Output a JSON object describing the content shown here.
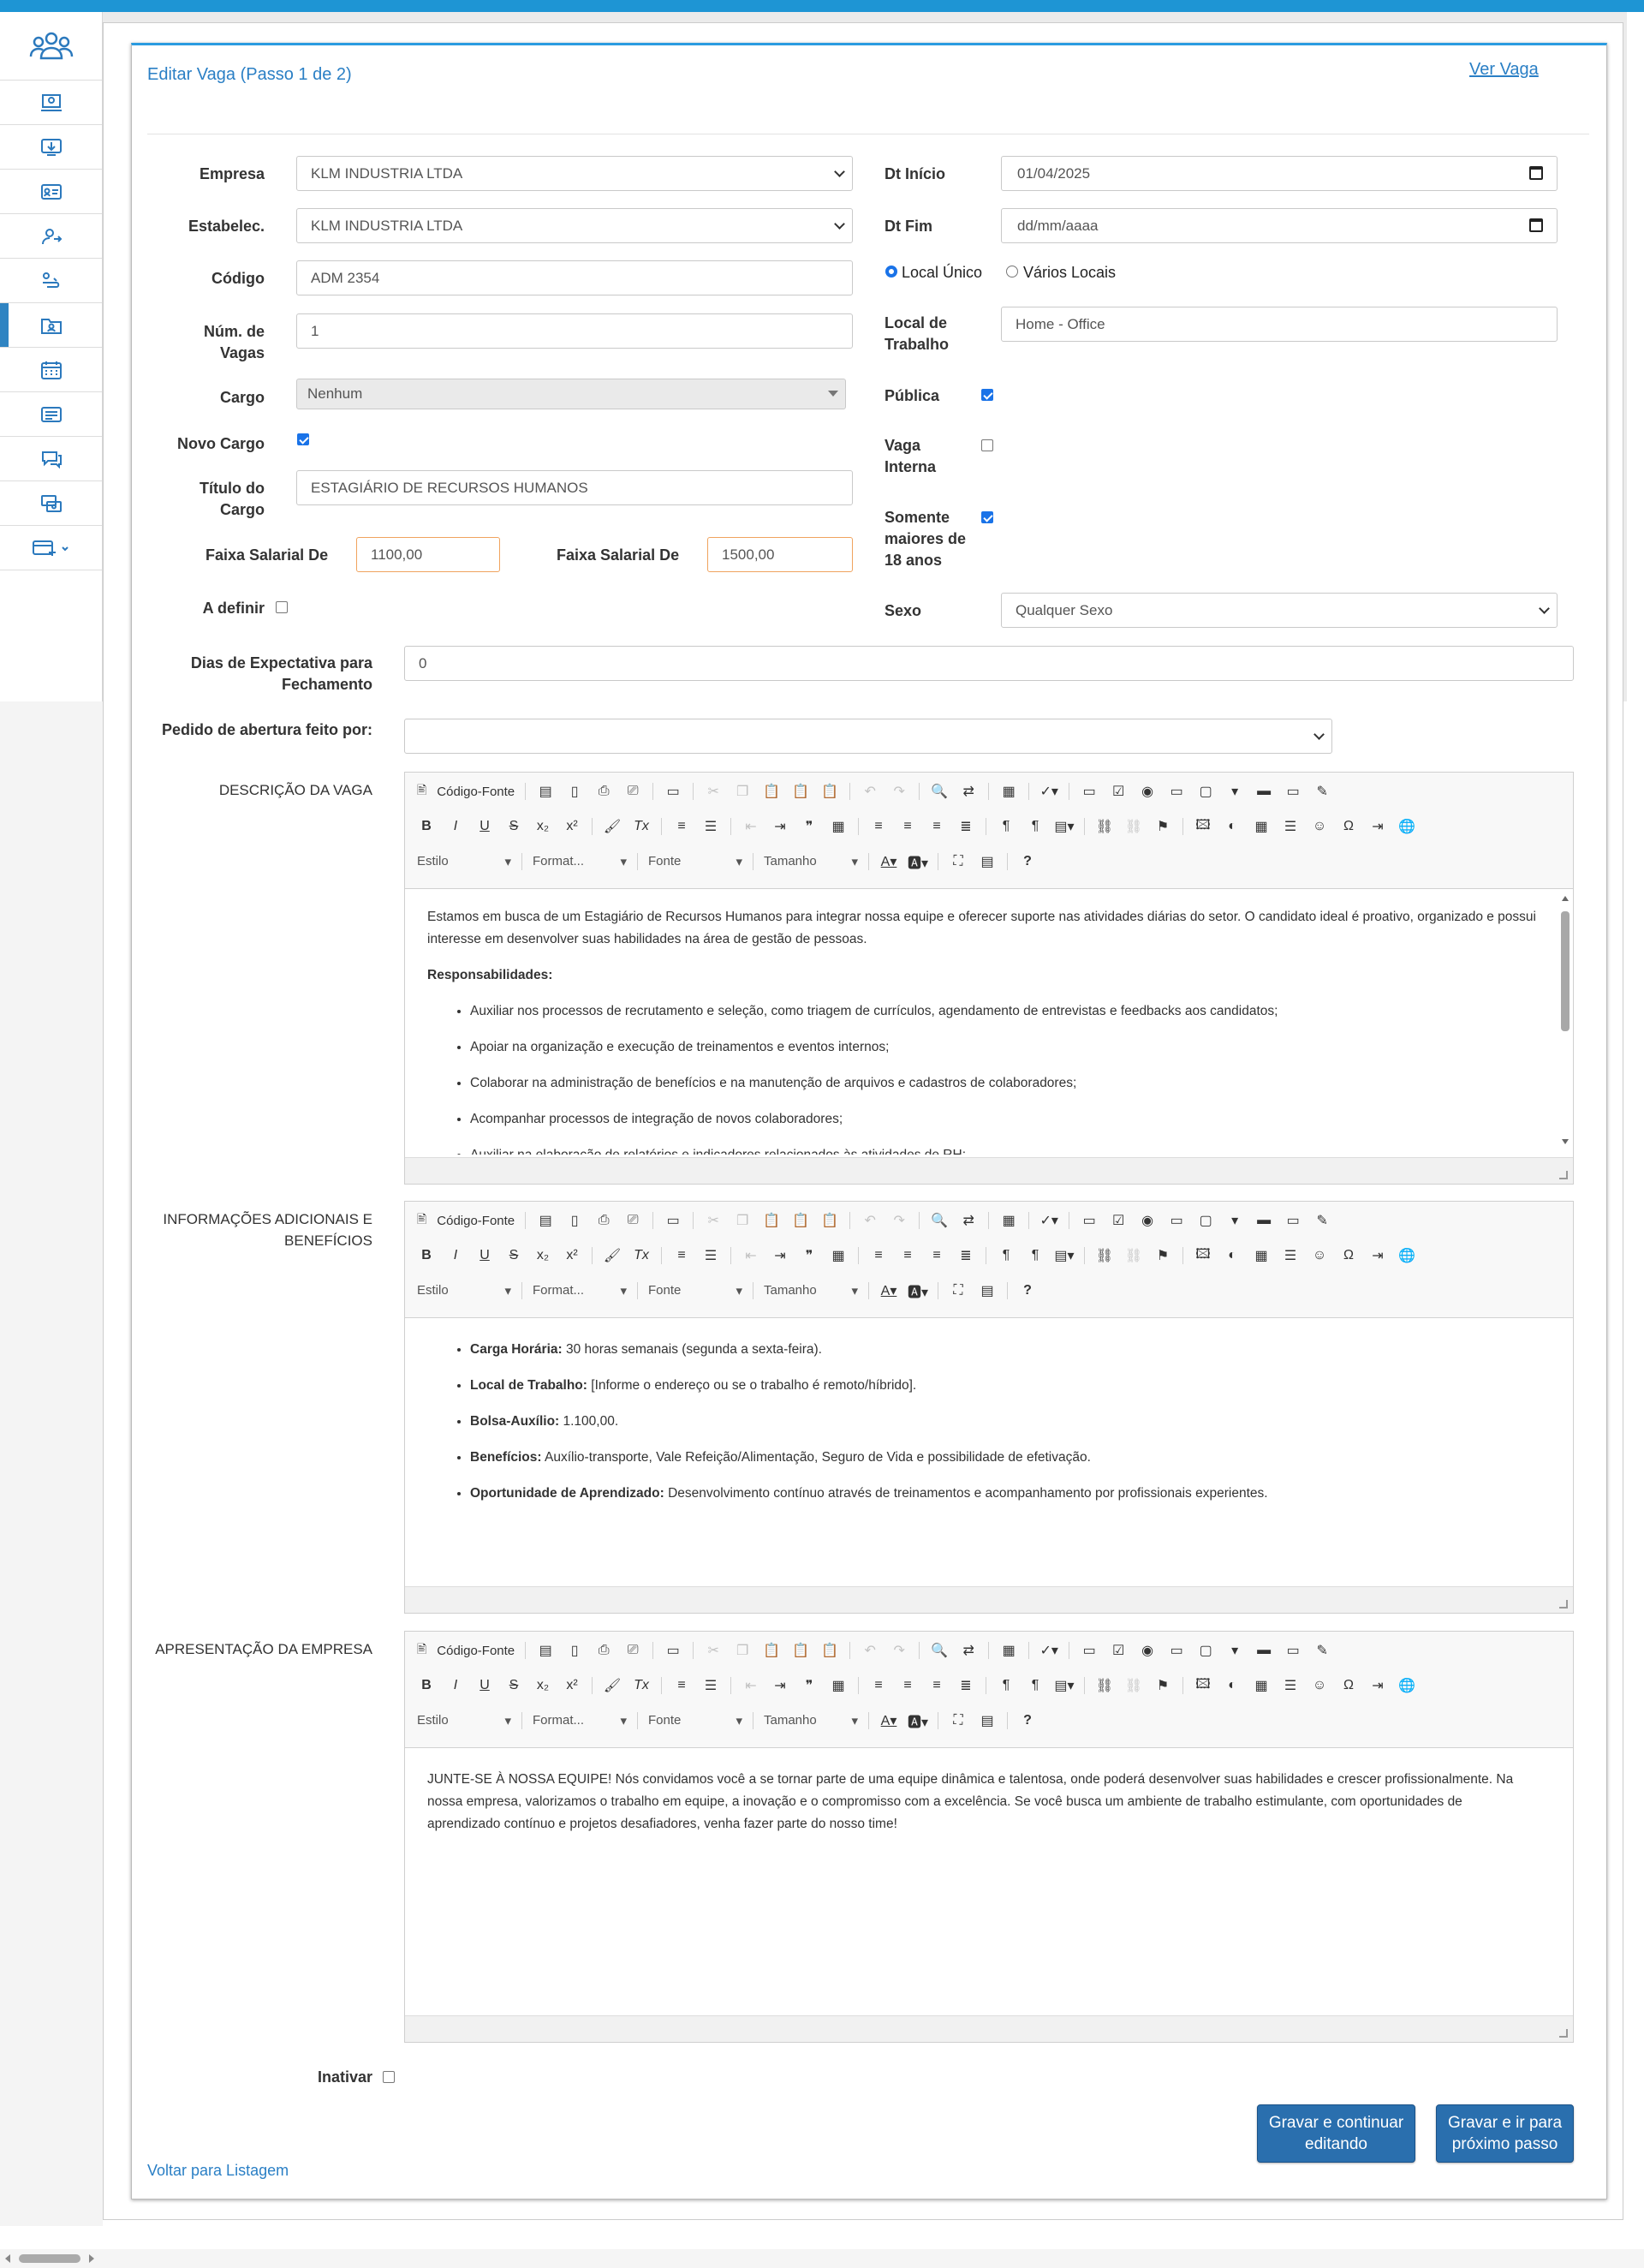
{
  "header": {
    "title": "Editar Vaga (Passo 1 de 2)",
    "view_link": "Ver Vaga"
  },
  "sidebar": {
    "items": [
      "team-icon",
      "computer-user-icon",
      "download-screen-icon",
      "id-card-icon",
      "user-transfer-icon",
      "user-path-icon",
      "folder-user-icon",
      "calendar-icon",
      "card-list-icon",
      "chat-icon",
      "money-transfer-icon",
      "add-card-icon"
    ]
  },
  "form": {
    "empresa": {
      "label": "Empresa",
      "value": "KLM INDUSTRIA LTDA"
    },
    "estabelec": {
      "label": "Estabelec.",
      "value": "KLM INDUSTRIA LTDA"
    },
    "codigo": {
      "label": "Código",
      "value": "ADM 2354"
    },
    "num_vagas": {
      "label": "Núm. de Vagas",
      "value": "1"
    },
    "cargo": {
      "label": "Cargo",
      "value": "Nenhum"
    },
    "novo_cargo": {
      "label": "Novo Cargo",
      "checked": true
    },
    "titulo_cargo": {
      "label": "Título do Cargo",
      "value": "ESTAGIÁRIO DE RECURSOS HUMANOS"
    },
    "faixa_de": {
      "label": "Faixa Salarial De",
      "value": "1100,00"
    },
    "faixa_ate": {
      "label": "Faixa Salarial De",
      "value": "1500,00"
    },
    "a_definir": {
      "label": "A definir",
      "checked": false
    },
    "dt_inicio": {
      "label": "Dt Início",
      "value": "01/04/2025"
    },
    "dt_fim": {
      "label": "Dt Fim",
      "value": "dd/mm/aaaa"
    },
    "local_unico": {
      "label": "Local Único",
      "checked": true
    },
    "varios_locais": {
      "label": "Vários Locais",
      "checked": false
    },
    "local_trabalho": {
      "label": "Local de Trabalho",
      "value": "Home - Office"
    },
    "publica": {
      "label": "Pública",
      "checked": true
    },
    "vaga_interna": {
      "label": "Vaga Interna",
      "checked": false
    },
    "maiores18": {
      "label": "Somente maiores de 18 anos",
      "checked": true
    },
    "sexo": {
      "label": "Sexo",
      "value": "Qualquer Sexo"
    },
    "dias_expectativa": {
      "label": "Dias de Expectativa para Fechamento",
      "value": "0"
    },
    "pedido_abertura": {
      "label": "Pedido de abertura feito por:",
      "value": ""
    },
    "inativar": {
      "label": "Inativar",
      "checked": false
    }
  },
  "toolbar": {
    "source": "Código-Fonte",
    "estilo": "Estilo",
    "formato": "Format...",
    "fonte": "Fonte",
    "tamanho": "Tamanho"
  },
  "descricao": {
    "label": "DESCRIÇÃO DA VAGA",
    "intro": "Estamos em busca de um Estagiário de Recursos Humanos para integrar nossa equipe e oferecer suporte nas atividades diárias do setor. O candidato ideal é proativo, organizado e possui interesse em desenvolver suas habilidades na área de gestão de pessoas.",
    "resp_title": "Responsabilidades:",
    "items": [
      "Auxiliar nos processos de recrutamento e seleção, como triagem de currículos, agendamento de entrevistas e feedbacks aos candidatos;",
      "Apoiar na organização e execução de treinamentos e eventos internos;",
      "Colaborar na administração de benefícios e na manutenção de arquivos e cadastros de colaboradores;",
      "Acompanhar processos de integração de novos colaboradores;",
      "Auxiliar na elaboração de relatórios e indicadores relacionados às atividades de RH;"
    ]
  },
  "info": {
    "label": "INFORMAÇÕES ADICIONAIS E BENEFÍCIOS",
    "items": [
      {
        "k": "Carga Horária:",
        "v": " 30 horas semanais (segunda a sexta-feira)."
      },
      {
        "k": "Local de Trabalho:",
        "v": " [Informe o endereço ou se o trabalho é remoto/híbrido]."
      },
      {
        "k": "Bolsa-Auxílio:",
        "v": " 1.100,00."
      },
      {
        "k": "Benefícios:",
        "v": " Auxílio-transporte, Vale Refeição/Alimentação, Seguro de Vida e possibilidade de efetivação."
      },
      {
        "k": "Oportunidade de Aprendizado:",
        "v": " Desenvolvimento contínuo através de treinamentos e acompanhamento por profissionais experientes."
      }
    ]
  },
  "apresentacao": {
    "label": "APRESENTAÇÃO DA EMPRESA",
    "text": "JUNTE-SE À NOSSA EQUIPE! Nós convidamos você a se tornar parte de uma equipe dinâmica e talentosa, onde poderá desenvolver suas habilidades e crescer profissionalmente. Na nossa empresa, valorizamos o trabalho em equipe, a inovação e o compromisso com a excelência. Se você busca um ambiente de trabalho estimulante, com oportunidades de aprendizado contínuo e projetos desafiadores, venha fazer parte do nosso time!"
  },
  "actions": {
    "save_continue": "Gravar e continuar editando",
    "save_next": "Gravar e ir para próximo passo",
    "back": "Voltar para Listagem"
  },
  "colors": {
    "accent": "#2a7fc5",
    "topbar": "#1e95d4",
    "button": "#2a6fae"
  }
}
